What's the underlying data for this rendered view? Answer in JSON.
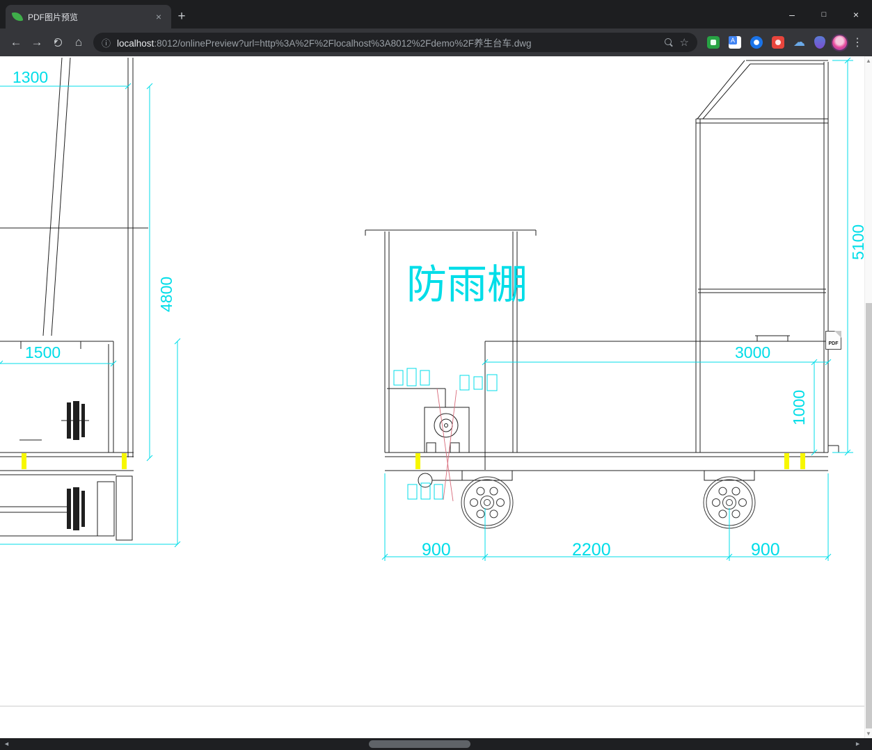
{
  "browser": {
    "tab": {
      "title": "PDF图片预览",
      "close_glyph": "×"
    },
    "new_tab_glyph": "+",
    "window_controls": {
      "minimize": "–",
      "maximize": "□",
      "close": "×"
    },
    "nav": {
      "back": "←",
      "forward": "→",
      "home": "⌂"
    },
    "omnibox": {
      "info_glyph": "ⓘ",
      "url_domain": "localhost",
      "url_rest": ":8012/onlinePreview?url=http%3A%2F%2Flocalhost%3A8012%2Fdemo%2F养生台车.dwg",
      "bookmark_glyph": "☆"
    },
    "menu_glyph": "⋮",
    "cloud_glyph": "☁"
  },
  "scrollbar": {
    "up": "▲",
    "down": "▼",
    "left": "◄",
    "right": "►"
  },
  "drawing": {
    "canopy_label": "防雨棚",
    "pdf_badge": "PDF",
    "dims": {
      "d1300": "1300",
      "d4800": "4800",
      "d1500": "1500",
      "d5100": "5100",
      "d3000": "3000",
      "d1000": "1000",
      "d900_left": "900",
      "d2200": "2200",
      "d900_right": "900"
    },
    "colors": {
      "dimension": "#00dde8",
      "line": "#1f1f1f",
      "highlight": "#f7f700",
      "leader": "#d86a7a"
    }
  }
}
